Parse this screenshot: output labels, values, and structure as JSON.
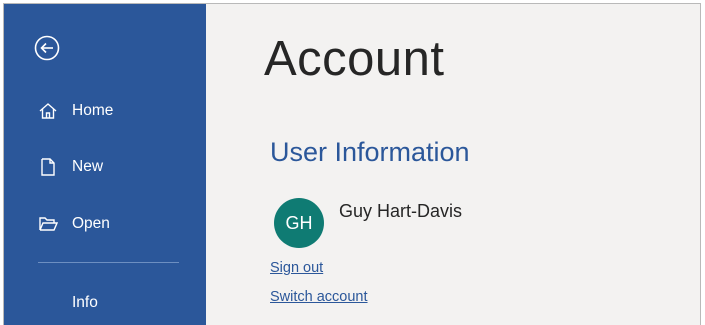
{
  "nav": {
    "back_icon": "back-arrow-circle-icon",
    "items": [
      {
        "label": "Home",
        "icon": "home-icon"
      },
      {
        "label": "New",
        "icon": "new-document-icon"
      },
      {
        "label": "Open",
        "icon": "open-folder-icon"
      },
      {
        "label": "Info",
        "icon": ""
      }
    ]
  },
  "page": {
    "title": "Account"
  },
  "user_info": {
    "heading": "User Information",
    "initials": "GH",
    "name": "Guy Hart-Davis",
    "sign_out": "Sign out",
    "switch_account": "Switch account"
  },
  "colors": {
    "nav_background": "#2b579a",
    "accent": "#2b579a",
    "avatar": "#0f7b73",
    "content_background": "#f3f2f1"
  }
}
